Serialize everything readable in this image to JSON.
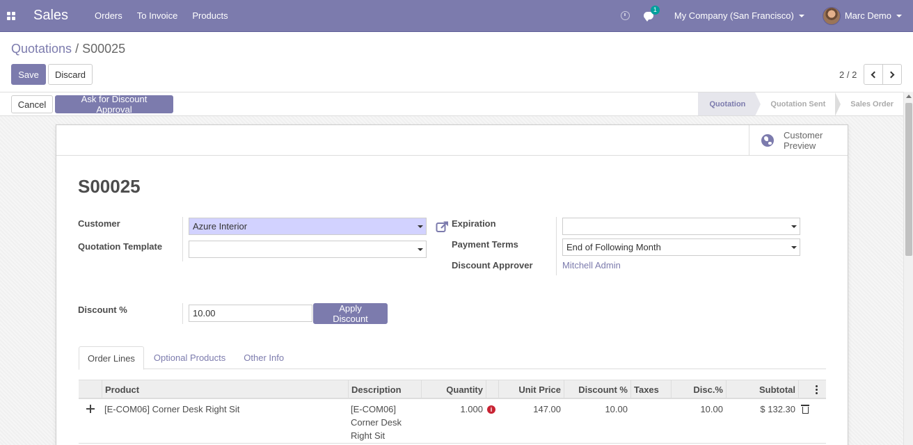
{
  "navbar": {
    "app_name": "Sales",
    "menu": [
      "Orders",
      "To Invoice",
      "Products"
    ],
    "message_count": "1",
    "company": "My Company (San Francisco)",
    "user": "Marc Demo"
  },
  "breadcrumb": {
    "parent": "Quotations",
    "separator": "/",
    "current": "S00025"
  },
  "actions": {
    "save_label": "Save",
    "discard_label": "Discard"
  },
  "pager": {
    "value": "2 / 2"
  },
  "statusbar": {
    "cancel_label": "Cancel",
    "approval_label": "Ask for Discount Approval",
    "stages": [
      "Quotation",
      "Quotation Sent",
      "Sales Order"
    ],
    "active_stage": "Quotation"
  },
  "sheet": {
    "preview_label": "Customer Preview",
    "title": "S00025",
    "fields": {
      "customer_label": "Customer",
      "customer_value": "Azure Interior",
      "template_label": "Quotation Template",
      "template_value": "",
      "expiration_label": "Expiration",
      "expiration_value": "",
      "payment_terms_label": "Payment Terms",
      "payment_terms_value": "End of Following Month",
      "approver_label": "Discount Approver",
      "approver_value": "Mitchell Admin",
      "discount_label": "Discount %",
      "discount_value": "10.00",
      "apply_label": "Apply Discount"
    },
    "tabs": [
      "Order Lines",
      "Optional Products",
      "Other Info"
    ],
    "active_tab": "Order Lines",
    "table": {
      "columns": [
        "Product",
        "Description",
        "Quantity",
        "Unit Price",
        "Discount %",
        "Taxes",
        "Disc.%",
        "Subtotal"
      ],
      "rows": [
        {
          "product": "[E-COM06] Corner Desk Right Sit",
          "description": "[E-COM06] Corner Desk Right Sit",
          "quantity": "1.000",
          "unit_price": "147.00",
          "discount": "10.00",
          "taxes": "",
          "disc_pct": "10.00",
          "subtotal": "$ 132.30"
        }
      ]
    }
  },
  "colors": {
    "brand": "#7c7bad",
    "required_field": "#d2d2ff",
    "badge": "#00a09d",
    "warning": "#c82333"
  },
  "icons": [
    "apps-grid-icon",
    "clock-icon",
    "chat-icon",
    "globe-icon",
    "external-link-icon",
    "move-handle-icon",
    "info-icon",
    "trash-icon",
    "kebab-icon"
  ]
}
